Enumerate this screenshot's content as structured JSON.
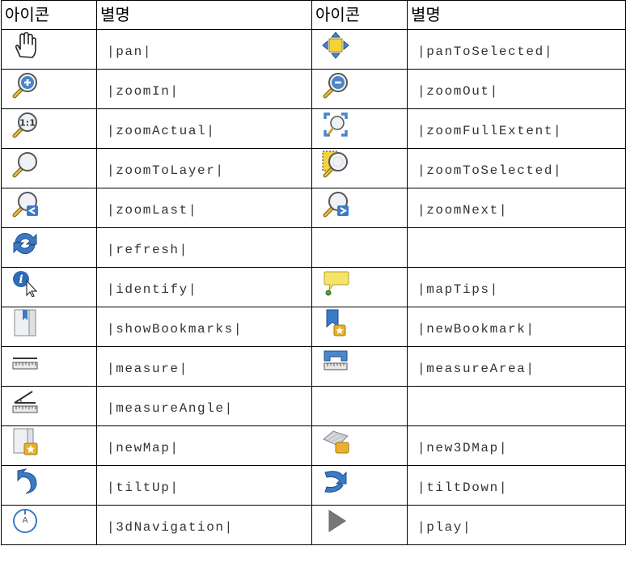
{
  "header": {
    "icon_col_1": "아이콘",
    "alias_col_1": "별명",
    "icon_col_2": "아이콘",
    "alias_col_2": "별명"
  },
  "rows": [
    {
      "left": {
        "icon": "pan-hand-icon",
        "alias": "|pan|"
      },
      "right": {
        "icon": "pan-to-selected-icon",
        "alias": "|panToSelected|"
      }
    },
    {
      "left": {
        "icon": "zoom-in-icon",
        "alias": "|zoomIn|"
      },
      "right": {
        "icon": "zoom-out-icon",
        "alias": "|zoomOut|"
      }
    },
    {
      "left": {
        "icon": "zoom-actual-icon",
        "alias": "|zoomActual|"
      },
      "right": {
        "icon": "zoom-full-extent-icon",
        "alias": "|zoomFullExtent|"
      }
    },
    {
      "left": {
        "icon": "zoom-to-layer-icon",
        "alias": "|zoomToLayer|"
      },
      "right": {
        "icon": "zoom-to-selected-icon",
        "alias": "|zoomToSelected|"
      }
    },
    {
      "left": {
        "icon": "zoom-last-icon",
        "alias": "|zoomLast|"
      },
      "right": {
        "icon": "zoom-next-icon",
        "alias": "|zoomNext|"
      }
    },
    {
      "left": {
        "icon": "refresh-icon",
        "alias": "|refresh|"
      },
      "right": null
    },
    {
      "left": {
        "icon": "identify-icon",
        "alias": "|identify|"
      },
      "right": {
        "icon": "map-tips-icon",
        "alias": "|mapTips|"
      }
    },
    {
      "left": {
        "icon": "show-bookmarks-icon",
        "alias": "|showBookmarks|"
      },
      "right": {
        "icon": "new-bookmark-icon",
        "alias": "|newBookmark|"
      }
    },
    {
      "left": {
        "icon": "measure-icon",
        "alias": "|measure|"
      },
      "right": {
        "icon": "measure-area-icon",
        "alias": "|measureArea|"
      }
    },
    {
      "left": {
        "icon": "measure-angle-icon",
        "alias": "|measureAngle|"
      },
      "right": null
    },
    {
      "left": {
        "icon": "new-map-icon",
        "alias": "|newMap|"
      },
      "right": {
        "icon": "new-3d-map-icon",
        "alias": "|new3DMap|"
      }
    },
    {
      "left": {
        "icon": "tilt-up-icon",
        "alias": "|tiltUp|"
      },
      "right": {
        "icon": "tilt-down-icon",
        "alias": "|tiltDown|"
      }
    },
    {
      "left": {
        "icon": "3d-navigation-icon",
        "alias": "|3dNavigation|"
      },
      "right": {
        "icon": "play-icon",
        "alias": "|play|"
      }
    }
  ]
}
